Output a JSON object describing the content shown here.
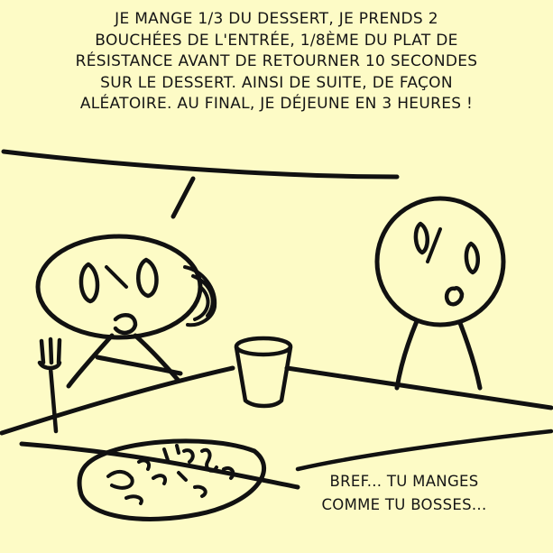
{
  "comic": {
    "speech_top": "JE MANGE 1/3 DU DESSERT, JE PRENDS 2\nBOUCHÉES DE L'ENTRÉE, 1/8ÈME DU PLAT DE\nRÉSISTANCE AVANT DE RETOURNER 10 SECONDES\nSUR LE DESSERT. AINSI DE SUITE, DE FAÇON\nALÉATOIRE. AU FINAL, JE DÉJEUNE EN 3 HEURES !",
    "speech_bottom": "BREF... TU MANGES\nCOMME TU BOSSES..."
  },
  "colors": {
    "background": "#fdfbc6",
    "ink": "#111111"
  }
}
